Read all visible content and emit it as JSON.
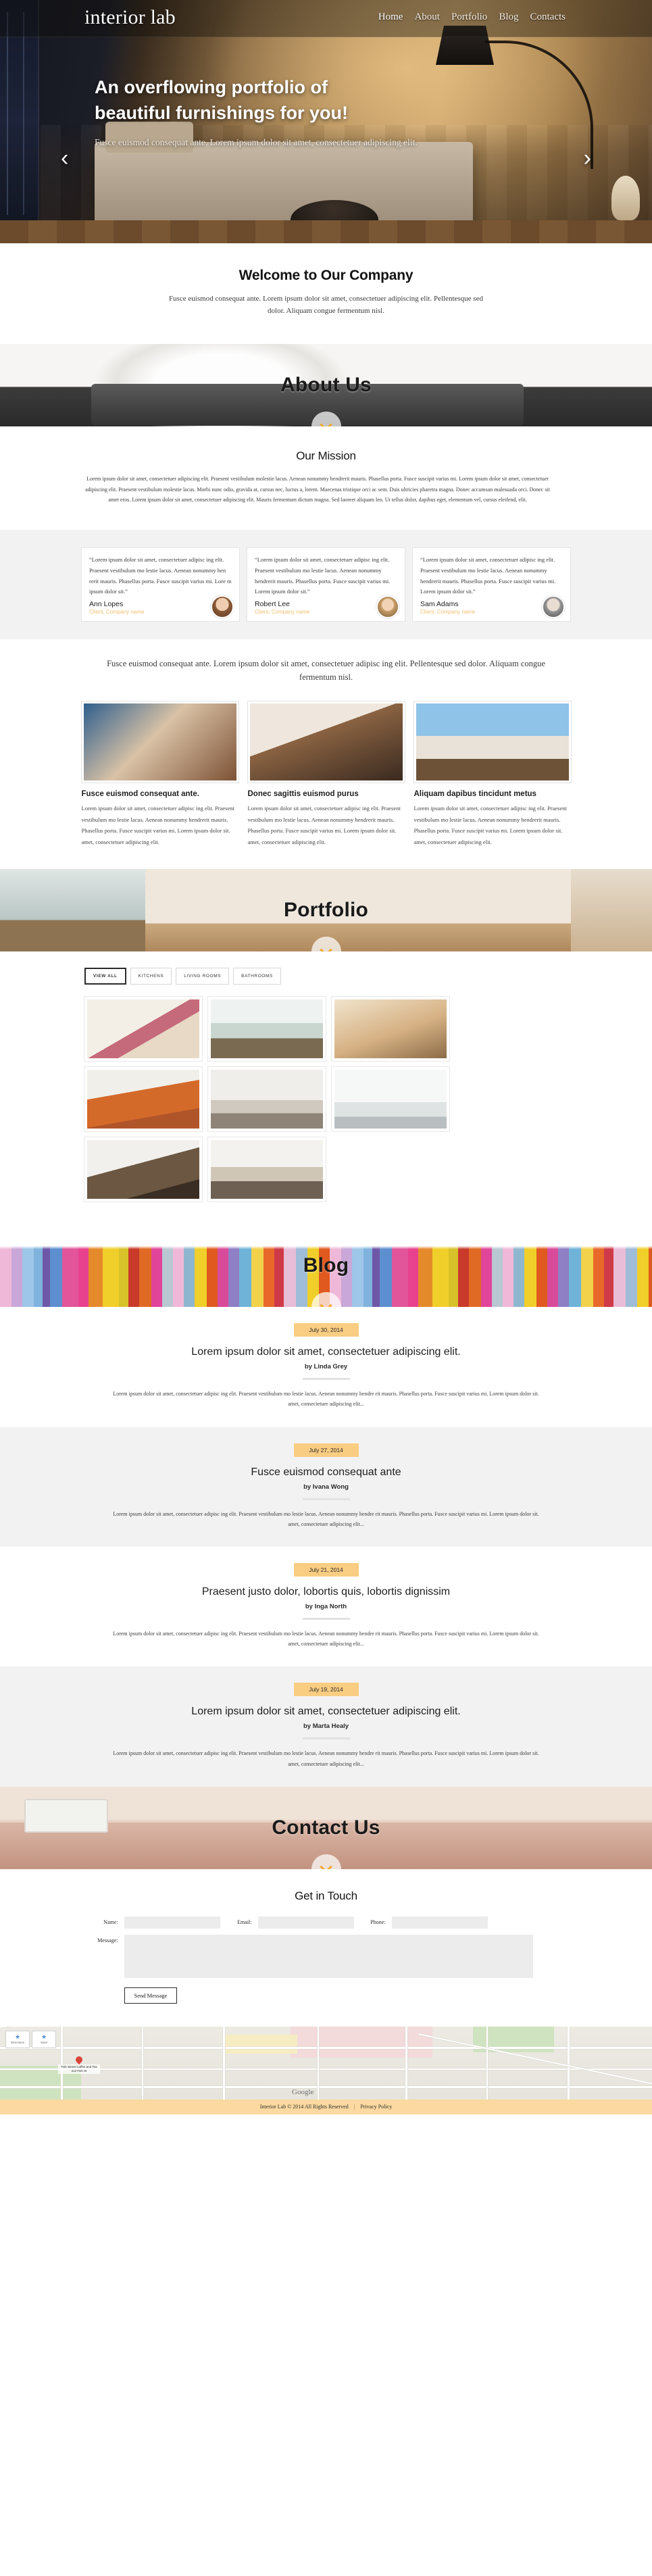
{
  "site": {
    "brand": "interior lab",
    "nav": [
      {
        "label": "Home",
        "active": true
      },
      {
        "label": "About",
        "active": false
      },
      {
        "label": "Portfolio",
        "active": false
      },
      {
        "label": "Blog",
        "active": false
      },
      {
        "label": "Contacts",
        "active": false
      }
    ]
  },
  "hero": {
    "headline_line1": "An overflowing portfolio of",
    "headline_line2": "beautiful furnishings for you!",
    "paragraph": "Fusce euismod consequat ante. Lorem ipsum dolor sit amet, consectetuer adipiscing elit.",
    "prev_arrow": "‹",
    "next_arrow": "›"
  },
  "welcome": {
    "title": "Welcome to Our Company",
    "text": "Fusce euismod consequat ante. Lorem ipsum dolor sit amet, consectetuer adipiscing elit. Pellentesque sed dolor. Aliquam congue fermentum nisl."
  },
  "about_banner": {
    "title": "About Us"
  },
  "mission": {
    "title": "Our Mission",
    "text": "Lorem ipsum dolor sit amet, consectetuer adipiscing elit. Praesent vestibulum molestie lacus. Aenean nonummy hendrerit mauris. Phasellus porta. Fusce suscipit varius mi. Lorem ipsum dolor sit amet, consectetuer adipiscing elit. Praesent vestibulum molestie lacus. Morbi nunc odio, gravida at, cursus nec, luctus a, lorem. Maecenas tristique orci ac sem. Duis ultricies pharetra magna. Donec accumsan malesuada orci. Donec sit amet eros. Lorem ipsum dolor sit amet, consectetuer adipiscing elit. Mauris fermentum dictum magna. Sed laoreet aliquam leo. Ut tellus dolor, dapibus eget, elementum vel, cursus eleifend, elit."
  },
  "testimonials": [
    {
      "quote": "“Lorem ipsum dolor sit amet, consectetuer adipisc ing elit. Praesent vestibulum mo lestie lacus. Aenean nonummy hen rerit mauris. Phasellus porta. Fusce suscipit varius mi. Lore m ipsum dolor sit.”",
      "name": "Ann Lopes",
      "role": "Client, Company name"
    },
    {
      "quote": "“Lorem ipsum dolor sit amet, consectetuer adipisc ing elit. Praesent vestibulum mo lestie lacus. Aenean nonummy hendrerit mauris. Phasellus porta. Fusce suscipit varius mi. Lorem ipsum dolor sit.”",
      "name": "Robert Lee",
      "role": "Client, Company name"
    },
    {
      "quote": "“Lorem ipsum dolor sit amet, consectetuer adipisc ing elit. Praesent vestibulum mo lestie lacus. Aenean nonummy hendrerit mauris. Phasellus porta. Fusce suscipit varius mi. Lorem ipsum dolor sit.”",
      "name": "Sam Adams",
      "role": "Client, Company name"
    }
  ],
  "services": {
    "intro": "Fusce euismod consequat ante. Lorem ipsum dolor sit amet, consectetuer adipisc ing elit. Pellentesque sed dolor. Aliquam congue fermentum nisl.",
    "cards": [
      {
        "title": "Fusce euismod consequat ante.",
        "text": "Lorem ipsum dolor sit amet, consectetuer adipisc ing elit. Praesent vestibulum mo lestie lacus. Aenean nonummy hendrerit mauris. Phasellus porta. Fusce suscipit varius mi. Lorem ipsum dolor sit. amet, consectetuer adipiscing elit."
      },
      {
        "title": "Donec sagittis euismod purus",
        "text": "Lorem ipsum dolor sit amet, consectetuer adipisc ing elit. Praesent vestibulum mo lestie lacus. Aenean nonummy hendrerit mauris. Phasellus porta. Fusce suscipit varius mi. Lorem ipsum dolor sit. amet, consectetuer adipiscing elit."
      },
      {
        "title": "Aliquam dapibus tincidunt metus",
        "text": "Lorem ipsum dolor sit amet, consectetuer adipisc ing elit. Praesent vestibulum mo lestie lacus. Aenean nonummy hendrerit mauris. Phasellus porta. Fusce suscipit varius mi. Lorem ipsum dolor sit. amet, consectetuer adipiscing elit."
      }
    ]
  },
  "portfolio_banner": {
    "title": "Portfolio"
  },
  "portfolio": {
    "filters": [
      {
        "label": "VIEW ALL",
        "active": true
      },
      {
        "label": "KITCHENS",
        "active": false
      },
      {
        "label": "LIVING ROOMS",
        "active": false
      },
      {
        "label": "BATHROOMS",
        "active": false
      }
    ],
    "tiles": [
      "living-room-white-sofa",
      "kitchen-white-cabinets",
      "bedroom-beige-cushions",
      "living-room-orange-sofa",
      "bedroom-monochrome-art",
      "bathroom-white-tub",
      "home-office-dark-desk",
      "living-room-glass-table"
    ]
  },
  "blog_banner": {
    "title": "Blog"
  },
  "posts": [
    {
      "date": "July 30, 2014",
      "title": "Lorem ipsum dolor sit amet, consectetuer adipiscing elit.",
      "author": "by Linda Grey",
      "excerpt": "Lorem ipsum dolor sit amet, consectetuer adipisc ing elit. Praesent vestibulum mo lestie lacus. Aenean nonummy hendre rit mauris. Phasellus porta. Fusce suscipit varius mi. Lorem ipsum dolor sit. amet, consectetuer adipiscing elit..."
    },
    {
      "date": "July 27, 2014",
      "title": "Fusce euismod consequat ante",
      "author": "by Ivana Wong",
      "excerpt": "Lorem ipsum dolor sit amet, consectetuer adipisc ing elit. Praesent vestibulum mo lestie lacus. Aenean nonummy hendre rit mauris. Phasellus porta. Fusce suscipit varius mi. Lorem ipsum dolor sit. amet, consectetuer adipiscing elit..."
    },
    {
      "date": "July 21, 2014",
      "title": "Praesent justo dolor, lobortis quis, lobortis dignissim",
      "author": "by Inga North",
      "excerpt": "Lorem ipsum dolor sit amet, consectetuer adipisc ing elit. Praesent vestibulum mo lestie lacus. Aenean nonummy hendre rit mauris. Phasellus porta. Fusce suscipit varius mi. Lorem ipsum dolor sit. amet, consectetuer adipiscing elit..."
    },
    {
      "date": "July 19, 2014",
      "title": "Lorem ipsum dolor sit amet, consectetuer adipiscing elit.",
      "author": "by Marta Healy",
      "excerpt": "Lorem ipsum dolor sit amet, consectetuer adipisc ing elit. Praesent vestibulum mo lestie lacus. Aenean nonummy hendre rit mauris. Phasellus porta. Fusce suscipit varius mi. Lorem ipsum dolor sit. amet, consectetuer adipiscing elit..."
    }
  ],
  "contact_banner": {
    "title": "Contact Us"
  },
  "contact": {
    "title": "Get in Touch",
    "name_label": "Name:",
    "email_label": "Email:",
    "phone_label": "Phone:",
    "message_label": "Message:",
    "name_value": "",
    "email_value": "",
    "phone_value": "",
    "message_value": "",
    "submit_label": "Send Message"
  },
  "map": {
    "directions_label": "Directions",
    "save_label": "Save",
    "directions_icon": "★",
    "save_icon": "★",
    "place_label": "Fish Street Coffee and Tea 212 Fish St",
    "provider": "Google"
  },
  "footer": {
    "copyright": "Interior Lab © 2014 All Rights Reserved",
    "separator": "|",
    "privacy": "Privacy Policy"
  },
  "colors": {
    "accent": "#f9cd82",
    "footer_bg": "#fbd9a0",
    "testimonial_role": "#f0c070",
    "chevron": "#f0a830"
  }
}
